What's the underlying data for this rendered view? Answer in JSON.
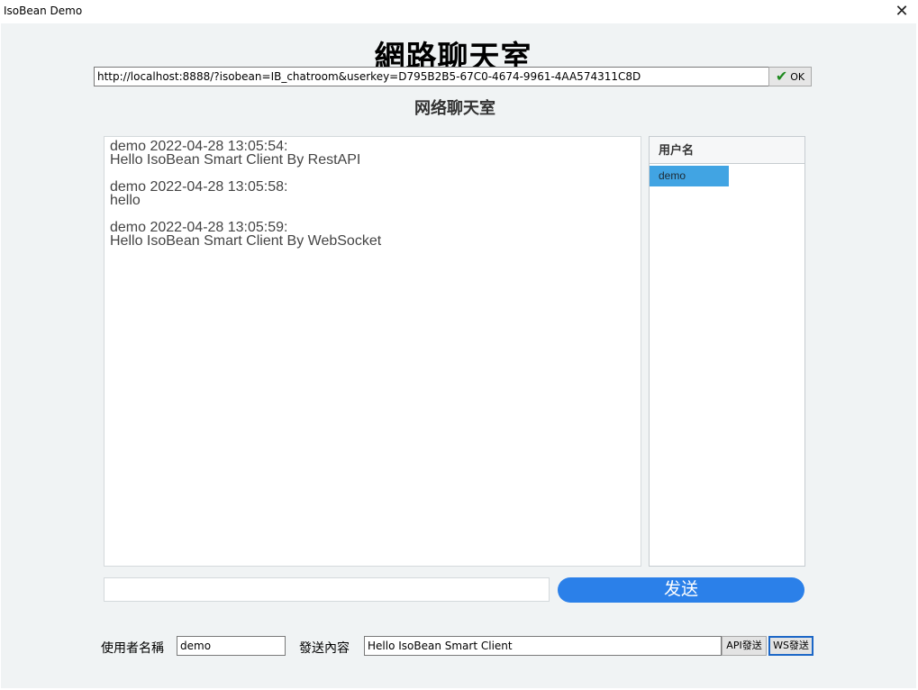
{
  "window": {
    "title": "IsoBean Demo",
    "close_glyph": "✕"
  },
  "app_title": "網路聊天室",
  "address_bar": {
    "url": "http://localhost:8888/?isobean=IB_chatroom&userkey=D795B2B5-67C0-4674-9961-4AA574311C8D",
    "ok_label": "OK",
    "ok_icon": "checkmark-icon"
  },
  "web": {
    "title": "网络聊天室",
    "messages": [
      {
        "header": "demo 2022-04-28 13:05:54:",
        "text": "Hello IsoBean Smart Client By RestAPI"
      },
      {
        "header": "demo 2022-04-28 13:05:58:",
        "text": "hello"
      },
      {
        "header": "demo 2022-04-28 13:05:59:",
        "text": "Hello IsoBean Smart Client By WebSocket"
      }
    ],
    "users_header": "用户名",
    "users": [
      "demo"
    ],
    "message_input_value": "",
    "send_label": "发送"
  },
  "bottom": {
    "username_label": "使用者名稱",
    "username_value": "demo",
    "content_label": "發送內容",
    "content_value": "Hello IsoBean Smart Client",
    "api_send_label": "API發送",
    "ws_send_label": "WS發送"
  },
  "colors": {
    "send_button": "#2b80e9",
    "selected_user": "#41a4e3",
    "client_background": "#f0f3f4"
  }
}
